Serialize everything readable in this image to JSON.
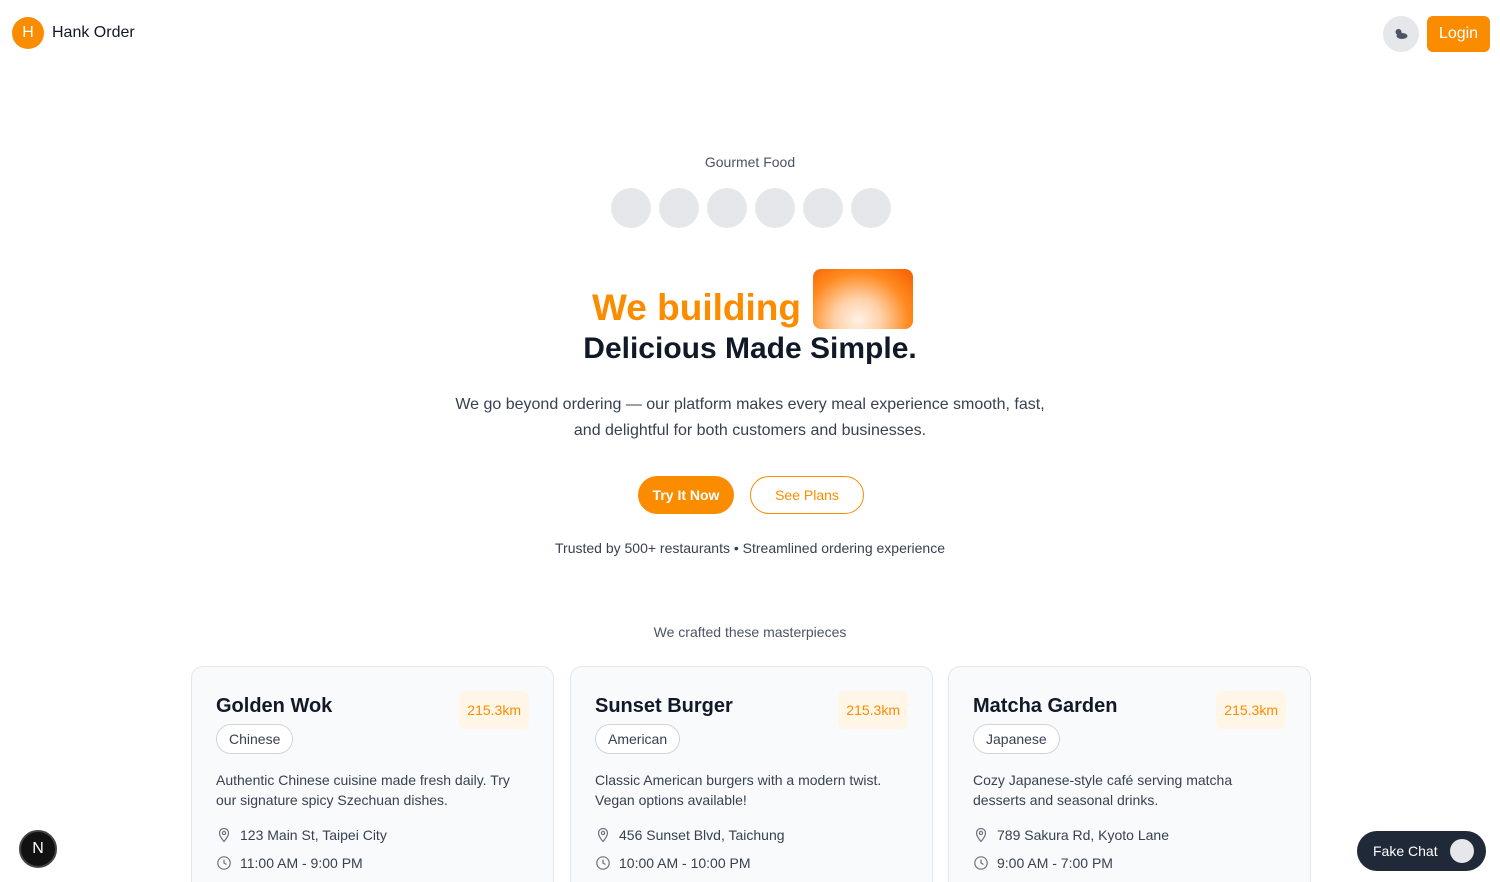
{
  "header": {
    "brand_initial": "H",
    "brand_name": "Hank Order",
    "theme_icon": "cloud-icon",
    "login_label": "Login"
  },
  "hero": {
    "eyebrow": "Gourmet Food",
    "avatar_count": 6,
    "headline_accent": "We building",
    "headline_main": "Delicious Made Simple.",
    "description": "We go beyond ordering — our platform makes every meal experience smooth, fast, and delightful for both customers and businesses.",
    "primary_cta": "Try It Now",
    "secondary_cta": "See Plans",
    "trust": "Trusted by 500+ restaurants • Streamlined ordering experience"
  },
  "section": {
    "label": "We crafted these masterpieces"
  },
  "cards": [
    {
      "title": "Golden Wok",
      "distance": "215.3km",
      "cuisine": "Chinese",
      "description": "Authentic Chinese cuisine made fresh daily. Try our signature spicy Szechuan dishes.",
      "address": "123 Main St, Taipei City",
      "hours": "11:00 AM - 9:00 PM"
    },
    {
      "title": "Sunset Burger",
      "distance": "215.3km",
      "cuisine": "American",
      "description": "Classic American burgers with a modern twist. Vegan options available!",
      "address": "456 Sunset Blvd, Taichung",
      "hours": "10:00 AM - 10:00 PM"
    },
    {
      "title": "Matcha Garden",
      "distance": "215.3km",
      "cuisine": "Japanese",
      "description": "Cozy Japanese-style café serving matcha desserts and seasonal drinks.",
      "address": "789 Sakura Rd, Kyoto Lane",
      "hours": "9:00 AM - 7:00 PM"
    }
  ],
  "floating": {
    "dev_badge": "N",
    "chat_label": "Fake Chat"
  },
  "colors": {
    "accent": "#fb8c00",
    "dark": "#1f2937"
  }
}
